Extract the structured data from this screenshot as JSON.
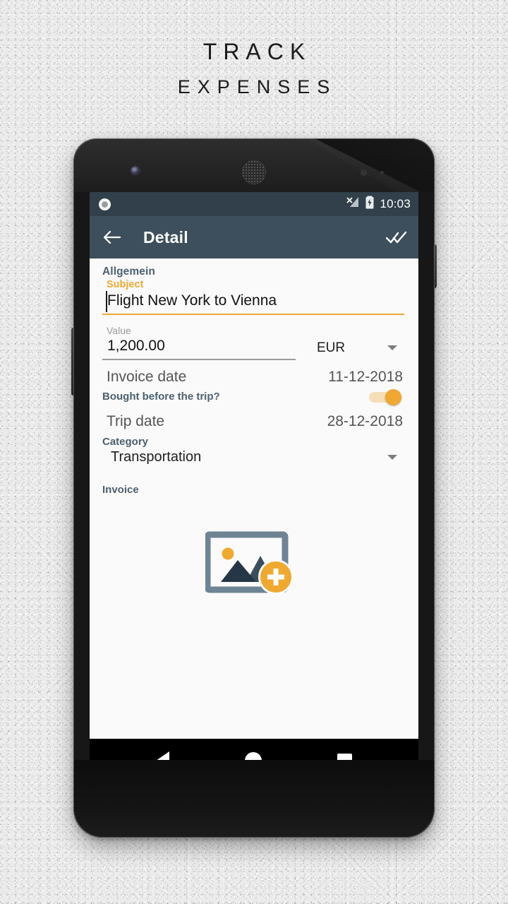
{
  "promo": {
    "line1": "Track",
    "line2": "expenses"
  },
  "statusbar": {
    "notification_icon": "circle-notification-icon",
    "signal_icon": "signal-off-icon",
    "battery_icon": "battery-charging-icon",
    "time": "10:03"
  },
  "appbar": {
    "back_icon": "back-arrow-icon",
    "title": "Detail",
    "done_icon": "done-all-icon"
  },
  "form": {
    "section_general": "Allgemein",
    "subject": {
      "label": "Subject",
      "value": "Flight New York to Vienna"
    },
    "value": {
      "label": "Value",
      "amount": "1,200.00",
      "currency": "EUR",
      "currency_dropdown_icon": "chevron-down-icon"
    },
    "invoice_date": {
      "label": "Invoice date",
      "value": "11-12-2018"
    },
    "bought_before_trip": {
      "label": "Bought before the trip?",
      "state": "on"
    },
    "trip_date": {
      "label": "Trip date",
      "value": "28-12-2018"
    },
    "category": {
      "label": "Category",
      "value": "Transportation",
      "dropdown_icon": "chevron-down-icon"
    },
    "invoice": {
      "label": "Invoice",
      "add_image_icon": "add-photo-icon"
    }
  },
  "navbar": {
    "back": "nav-back-triangle-icon",
    "home": "nav-home-circle-icon",
    "recents": "nav-recents-square-icon"
  },
  "colors": {
    "accent_orange": "#efa832",
    "appbar": "#3d4f5c",
    "statusbar": "#31404a",
    "slate_label": "#4c6070",
    "screen_bg": "#fafafa"
  }
}
